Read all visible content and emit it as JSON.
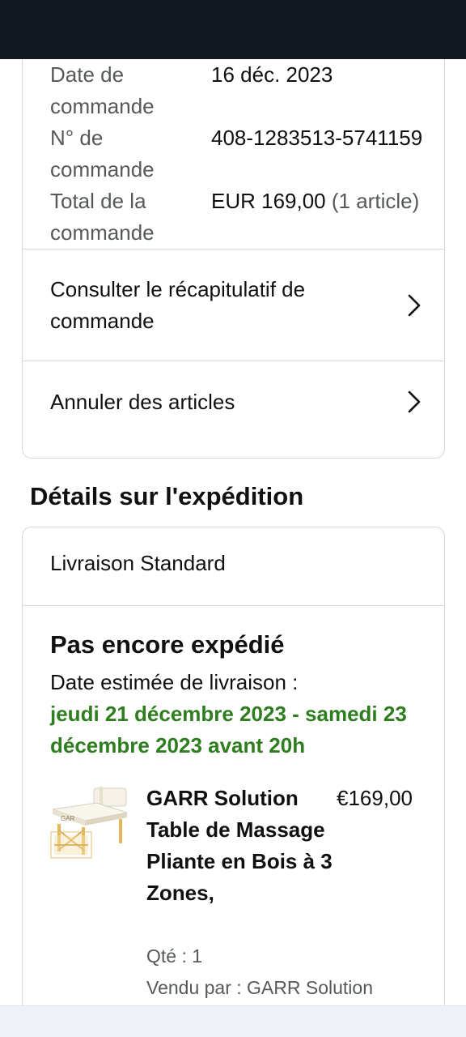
{
  "order_info": {
    "rows": [
      {
        "label": "Date de commande",
        "value": "16 déc. 2023",
        "value_extra": ""
      },
      {
        "label": "N° de commande",
        "value": "408-1283513-5741159",
        "value_extra": ""
      },
      {
        "label": "Total de la commande",
        "value": "EUR 169,00",
        "value_extra": " (1 article)"
      }
    ]
  },
  "actions": {
    "summary_label": "Consulter le récapitulatif de commande",
    "cancel_label": "Annuler des articles"
  },
  "shipping": {
    "section_title": "Détails sur l'expédition",
    "method": "Livraison Standard",
    "status": "Pas encore expédié",
    "estimate_label": "Date estimée de livraison :",
    "estimate_date": "jeudi 21 décembre 2023 - samedi 23 décembre 2023 avant 20h"
  },
  "product": {
    "title": "GARR Solution Table de Massage Pliante en Bois à 3 Zones,",
    "price": "€169,00",
    "quantity": "Qté : 1",
    "seller": "Vendu par : GARR Solution"
  },
  "icons": {
    "chevron": "chevron-right-icon"
  }
}
